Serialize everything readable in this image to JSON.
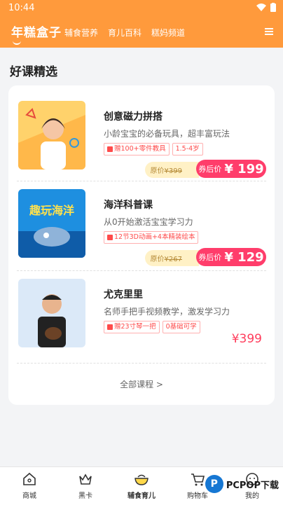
{
  "status": {
    "time": "10:44"
  },
  "header": {
    "logo": "年糕盒子",
    "nav": [
      "辅食营养",
      "育儿百科",
      "糕妈频道"
    ]
  },
  "section_title": "好课精选",
  "courses": [
    {
      "title": "创意磁力拼搭",
      "desc": "小龄宝宝的必备玩具，超丰富玩法",
      "tags": [
        "赠100+零件教具",
        "1.5-4岁"
      ],
      "orig_label": "原价",
      "orig_price": "¥399",
      "coupon_label": "券后价",
      "coupon_price": "¥ 199"
    },
    {
      "title": "海洋科普课",
      "desc": "从0开始激活宝宝学习力",
      "tags": [
        "12节3D动画+4本精装绘本"
      ],
      "img_text": "趣玩海洋",
      "orig_label": "原价",
      "orig_price": "¥267",
      "coupon_label": "券后价",
      "coupon_price": "¥ 129"
    },
    {
      "title": "尤克里里",
      "desc": "名师手把手视频教学，激发学习力",
      "tags": [
        "赠23寸琴一把",
        "0基础可学"
      ],
      "price": "¥399"
    }
  ],
  "all_courses": "全部课程 >",
  "tabbar": [
    {
      "label": "商城",
      "icon": "home-icon"
    },
    {
      "label": "黑卡",
      "icon": "crown-icon"
    },
    {
      "label": "辅食育儿",
      "icon": "bowl-icon"
    },
    {
      "label": "购物车",
      "icon": "cart-icon"
    },
    {
      "label": "我的",
      "icon": "profile-icon"
    }
  ],
  "watermark": "PCPOP下载",
  "colors": {
    "brand": "#ff9a3c",
    "accent": "#ff3d6b"
  }
}
